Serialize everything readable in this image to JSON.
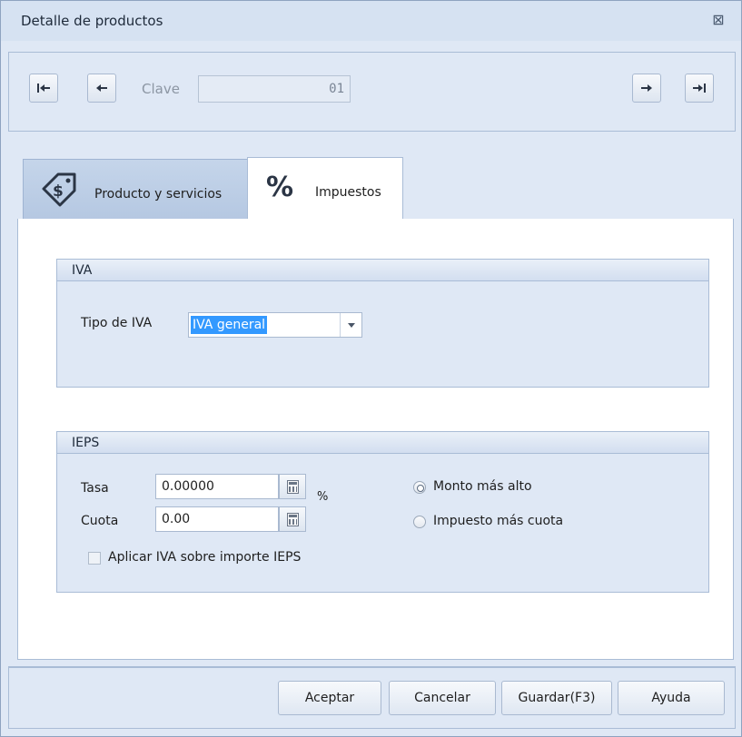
{
  "window": {
    "title": "Detalle de productos",
    "close_glyph": "⊠"
  },
  "nav": {
    "clave_label": "Clave",
    "clave_value": "01"
  },
  "tabs": [
    {
      "label": "Producto y servicios",
      "icon": "price-tag-icon"
    },
    {
      "label": "Impuestos",
      "icon": "percent-icon"
    }
  ],
  "iva": {
    "group_title": "IVA",
    "tipo_label": "Tipo de IVA",
    "tipo_value": "IVA general"
  },
  "ieps": {
    "group_title": "IEPS",
    "tasa_label": "Tasa",
    "tasa_value": "0.00000",
    "tasa_unit": "%",
    "cuota_label": "Cuota",
    "cuota_value": "0.00",
    "radio_monto": "Monto más alto",
    "radio_impuesto": "Impuesto más cuota",
    "aplicar_iva": "Aplicar IVA sobre importe IEPS"
  },
  "footer": {
    "aceptar": "Aceptar",
    "cancelar": "Cancelar",
    "guardar": "Guardar(F3)",
    "ayuda": "Ayuda"
  }
}
